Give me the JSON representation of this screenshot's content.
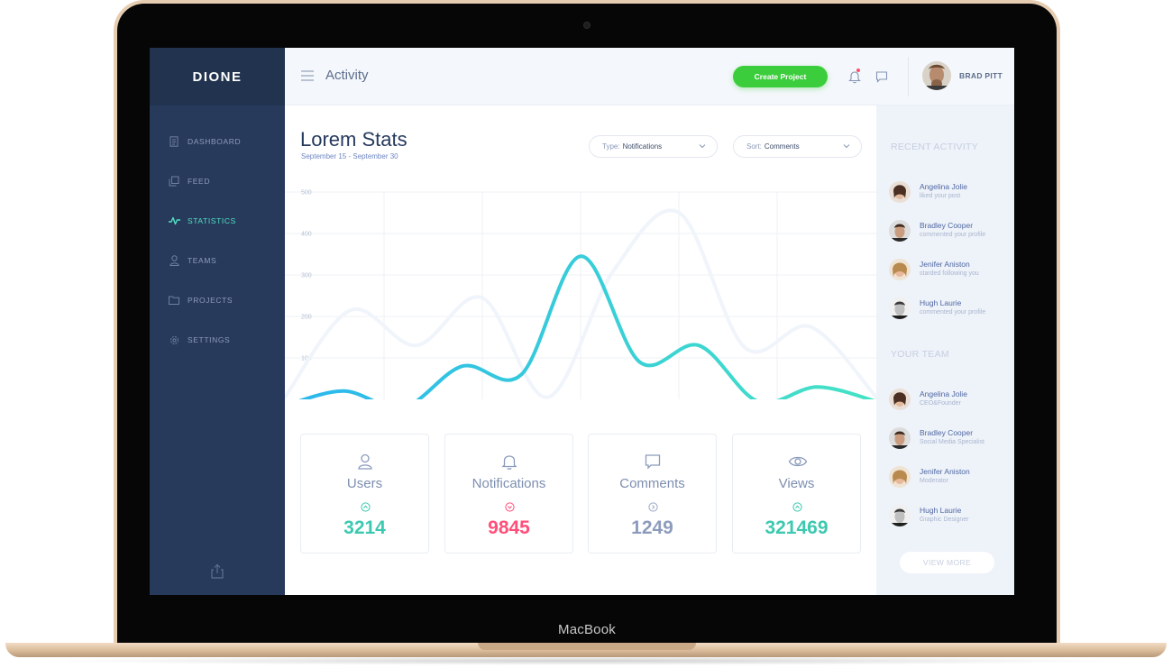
{
  "device": {
    "brand": "MacBook"
  },
  "app": {
    "logo": "DIONE"
  },
  "sidebar": {
    "items": [
      {
        "label": "DASHBOARD",
        "icon": "document-icon"
      },
      {
        "label": "FEED",
        "icon": "copy-icon"
      },
      {
        "label": "STATISTICS",
        "icon": "pulse-icon",
        "active": true
      },
      {
        "label": "TEAMS",
        "icon": "user-icon"
      },
      {
        "label": "PROJECTS",
        "icon": "folder-icon"
      },
      {
        "label": "SETTINGS",
        "icon": "gear-icon"
      }
    ],
    "footer_icon": "share-icon"
  },
  "topbar": {
    "title": "Activity",
    "create_button": "Create Project",
    "user_name": "BRAD PITT",
    "has_notification": true
  },
  "main": {
    "title": "Lorem Stats",
    "date_range": "September 15 - September 30",
    "filters": {
      "type_key": "Type:",
      "type_value": "Notifications",
      "sort_key": "Sort:",
      "sort_value": "Comments"
    }
  },
  "chart_data": {
    "type": "line",
    "yticks": [
      500,
      400,
      300,
      200,
      100
    ],
    "ylim": [
      0,
      500
    ],
    "grid": true,
    "series": [
      {
        "values": [
          5,
          215,
          130,
          245,
          5,
          310,
          450,
          125,
          175,
          5
        ]
      },
      {
        "values": [
          -15,
          20,
          -20,
          80,
          60,
          345,
          90,
          130,
          -5,
          30,
          -5
        ]
      }
    ],
    "colors": {
      "primary_start": "#2ab7ee",
      "primary_end": "#45e3c4",
      "secondary": "#f0f4fb",
      "grid": "#eef1f6"
    }
  },
  "cards": [
    {
      "label": "Users",
      "value": "3214",
      "icon": "user-icon",
      "trend": "up"
    },
    {
      "label": "Notifications",
      "value": "9845",
      "icon": "bell-icon",
      "trend": "down"
    },
    {
      "label": "Comments",
      "value": "1249",
      "icon": "comment-icon",
      "trend": "neutral"
    },
    {
      "label": "Views",
      "value": "321469",
      "icon": "eye-icon",
      "trend": "up"
    }
  ],
  "recent_activity": {
    "heading": "RECENT ACTIVITY",
    "items": [
      {
        "name": "Angelina Jolie",
        "text": "liked your post"
      },
      {
        "name": "Bradley Cooper",
        "text": "commented your profile"
      },
      {
        "name": "Jenifer Aniston",
        "text": "starded following you"
      },
      {
        "name": "Hugh Laurie",
        "text": "commented your profile"
      }
    ]
  },
  "team": {
    "heading": "YOUR TEAM",
    "members": [
      {
        "name": "Angelina Jolie",
        "role": "CEO&Founder"
      },
      {
        "name": "Bradley Cooper",
        "role": "Social Media Specialist"
      },
      {
        "name": "Jenifer Aniston",
        "role": "Moderator"
      },
      {
        "name": "Hugh Laurie",
        "role": "Graphic Designer"
      }
    ],
    "view_more": "VIEW MORE"
  }
}
